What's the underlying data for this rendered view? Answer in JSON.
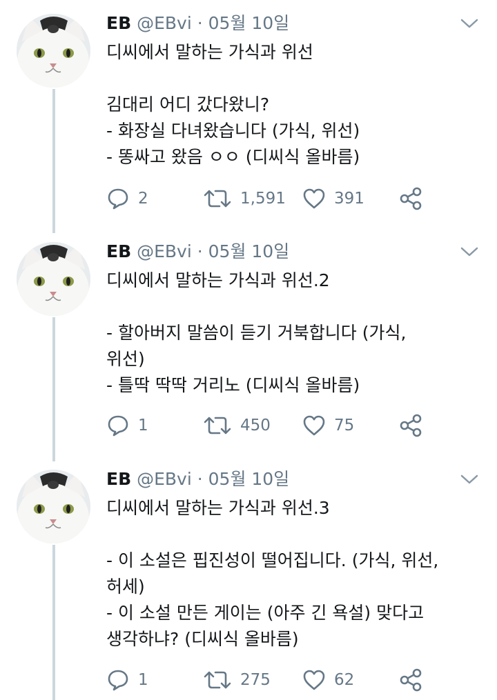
{
  "tweets": [
    {
      "name": "EB",
      "handle": "@EBvi",
      "separator": "·",
      "date": "05월 10일",
      "lines": [
        "디씨에서 말하는 가식과 위선",
        "",
        "김대리 어디 갔다왔니?",
        "- 화장실 다녀왔습니다 (가식, 위선)",
        "- 똥싸고 왔음 ㅇㅇ (디씨식 올바름)"
      ],
      "replies": "2",
      "retweets": "1,591",
      "likes": "391"
    },
    {
      "name": "EB",
      "handle": "@EBvi",
      "separator": "·",
      "date": "05월 10일",
      "lines": [
        "디씨에서 말하는 가식과 위선.2",
        "",
        "- 할아버지 말씀이 듣기 거북합니다 (가식,",
        "위선)",
        "- 틀딱 딱딱 거리노 (디씨식 올바름)"
      ],
      "replies": "1",
      "retweets": "450",
      "likes": "75"
    },
    {
      "name": "EB",
      "handle": "@EBvi",
      "separator": "·",
      "date": "05월 10일",
      "lines": [
        "디씨에서 말하는 가식과 위선.3",
        "",
        "- 이 소설은 핍진성이 떨어집니다. (가식, 위선,",
        "허세)",
        "- 이 소설 만든 게이는 (아주 긴 욕설) 맞다고",
        "생각하냐? (디씨식 올바름)"
      ],
      "replies": "1",
      "retweets": "275",
      "likes": "62"
    }
  ],
  "icons": {
    "reply": "reply-icon",
    "retweet": "retweet-icon",
    "like": "heart-icon",
    "share": "share-icon",
    "menu": "chevron-down-icon",
    "avatar": "cat-avatar-icon"
  },
  "colors": {
    "text": "#14171a",
    "muted": "#657786",
    "thread_line": "#ccd6dd"
  }
}
